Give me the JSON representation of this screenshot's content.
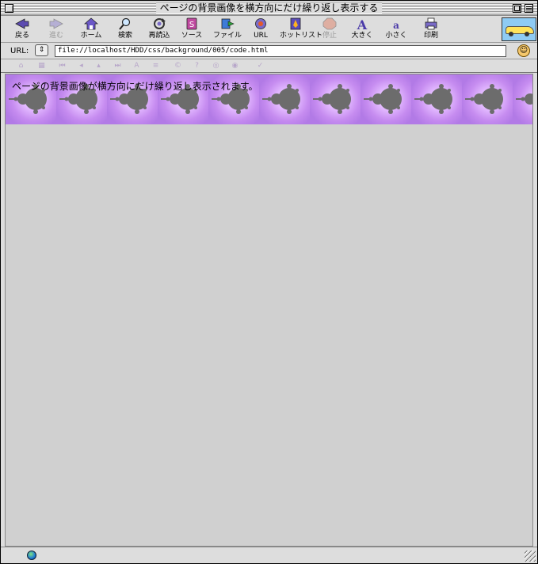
{
  "window": {
    "title": "ページの背景画像を横方向にだけ繰り返し表示する"
  },
  "toolbar": {
    "buttons": [
      {
        "label": "戻る",
        "icon": "back-arrow-icon",
        "enabled": true
      },
      {
        "label": "進む",
        "icon": "forward-arrow-icon",
        "enabled": false
      },
      {
        "label": "ホーム",
        "icon": "home-icon",
        "enabled": true
      },
      {
        "label": "検索",
        "icon": "search-icon",
        "enabled": true
      },
      {
        "label": "再読込",
        "icon": "reload-icon",
        "enabled": true
      },
      {
        "label": "ソース",
        "icon": "source-icon",
        "enabled": true
      },
      {
        "label": "ファイル",
        "icon": "file-icon",
        "enabled": true
      },
      {
        "label": "URL",
        "icon": "url-globe-icon",
        "enabled": true
      },
      {
        "label": "ホットリスト",
        "icon": "hotlist-icon",
        "enabled": true
      },
      {
        "label": "停止",
        "icon": "stop-icon",
        "enabled": false
      },
      {
        "label": "大きく",
        "icon": "text-larger-icon",
        "enabled": true
      },
      {
        "label": "小さく",
        "icon": "text-smaller-icon",
        "enabled": true
      },
      {
        "label": "印刷",
        "icon": "print-icon",
        "enabled": true
      }
    ]
  },
  "urlbar": {
    "label": "URL:",
    "url": "file://localhost/HDD/css/background/005/code.html"
  },
  "content": {
    "text": "ページの背景画像が横方向にだけ繰り返し表示されます。",
    "background_color": "#c8a0f0",
    "canvas_color": "#d0d0d0"
  }
}
